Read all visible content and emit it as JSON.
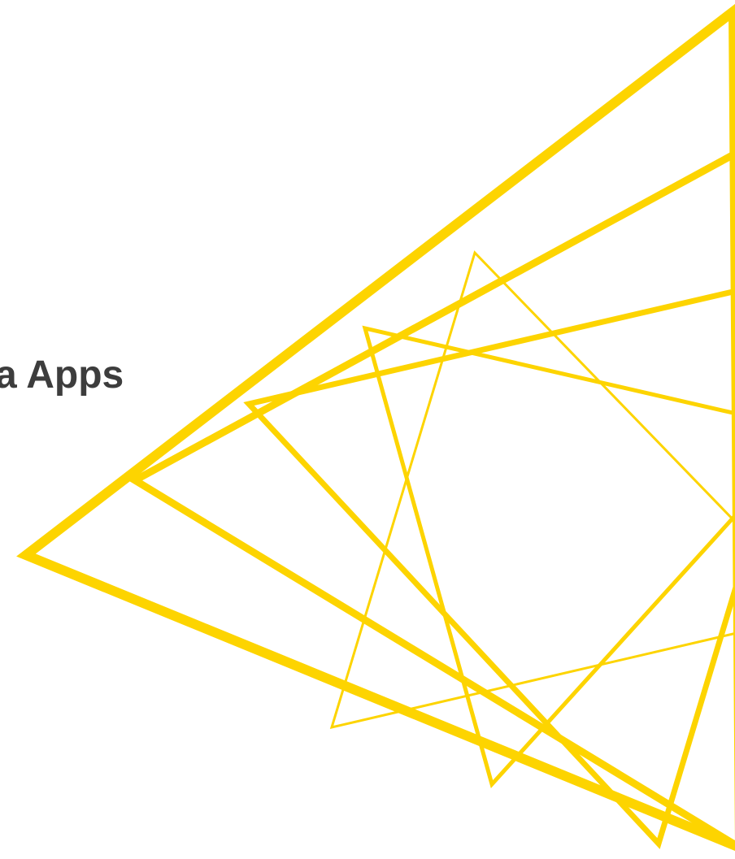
{
  "slide": {
    "title": "a Apps"
  },
  "colors": {
    "background": "#ffffff",
    "title_text": "#3d3d3d",
    "accent_lines": "#fdd400"
  }
}
